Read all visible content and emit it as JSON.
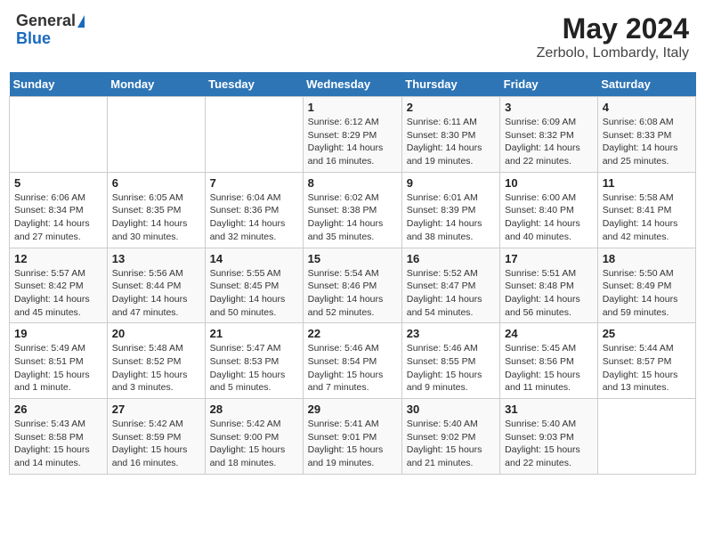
{
  "logo": {
    "line1": "General",
    "line2": "Blue"
  },
  "title": "May 2024",
  "subtitle": "Zerbolo, Lombardy, Italy",
  "days_header": [
    "Sunday",
    "Monday",
    "Tuesday",
    "Wednesday",
    "Thursday",
    "Friday",
    "Saturday"
  ],
  "weeks": [
    [
      {
        "num": "",
        "info": ""
      },
      {
        "num": "",
        "info": ""
      },
      {
        "num": "",
        "info": ""
      },
      {
        "num": "1",
        "info": "Sunrise: 6:12 AM\nSunset: 8:29 PM\nDaylight: 14 hours and 16 minutes."
      },
      {
        "num": "2",
        "info": "Sunrise: 6:11 AM\nSunset: 8:30 PM\nDaylight: 14 hours and 19 minutes."
      },
      {
        "num": "3",
        "info": "Sunrise: 6:09 AM\nSunset: 8:32 PM\nDaylight: 14 hours and 22 minutes."
      },
      {
        "num": "4",
        "info": "Sunrise: 6:08 AM\nSunset: 8:33 PM\nDaylight: 14 hours and 25 minutes."
      }
    ],
    [
      {
        "num": "5",
        "info": "Sunrise: 6:06 AM\nSunset: 8:34 PM\nDaylight: 14 hours and 27 minutes."
      },
      {
        "num": "6",
        "info": "Sunrise: 6:05 AM\nSunset: 8:35 PM\nDaylight: 14 hours and 30 minutes."
      },
      {
        "num": "7",
        "info": "Sunrise: 6:04 AM\nSunset: 8:36 PM\nDaylight: 14 hours and 32 minutes."
      },
      {
        "num": "8",
        "info": "Sunrise: 6:02 AM\nSunset: 8:38 PM\nDaylight: 14 hours and 35 minutes."
      },
      {
        "num": "9",
        "info": "Sunrise: 6:01 AM\nSunset: 8:39 PM\nDaylight: 14 hours and 38 minutes."
      },
      {
        "num": "10",
        "info": "Sunrise: 6:00 AM\nSunset: 8:40 PM\nDaylight: 14 hours and 40 minutes."
      },
      {
        "num": "11",
        "info": "Sunrise: 5:58 AM\nSunset: 8:41 PM\nDaylight: 14 hours and 42 minutes."
      }
    ],
    [
      {
        "num": "12",
        "info": "Sunrise: 5:57 AM\nSunset: 8:42 PM\nDaylight: 14 hours and 45 minutes."
      },
      {
        "num": "13",
        "info": "Sunrise: 5:56 AM\nSunset: 8:44 PM\nDaylight: 14 hours and 47 minutes."
      },
      {
        "num": "14",
        "info": "Sunrise: 5:55 AM\nSunset: 8:45 PM\nDaylight: 14 hours and 50 minutes."
      },
      {
        "num": "15",
        "info": "Sunrise: 5:54 AM\nSunset: 8:46 PM\nDaylight: 14 hours and 52 minutes."
      },
      {
        "num": "16",
        "info": "Sunrise: 5:52 AM\nSunset: 8:47 PM\nDaylight: 14 hours and 54 minutes."
      },
      {
        "num": "17",
        "info": "Sunrise: 5:51 AM\nSunset: 8:48 PM\nDaylight: 14 hours and 56 minutes."
      },
      {
        "num": "18",
        "info": "Sunrise: 5:50 AM\nSunset: 8:49 PM\nDaylight: 14 hours and 59 minutes."
      }
    ],
    [
      {
        "num": "19",
        "info": "Sunrise: 5:49 AM\nSunset: 8:51 PM\nDaylight: 15 hours and 1 minute."
      },
      {
        "num": "20",
        "info": "Sunrise: 5:48 AM\nSunset: 8:52 PM\nDaylight: 15 hours and 3 minutes."
      },
      {
        "num": "21",
        "info": "Sunrise: 5:47 AM\nSunset: 8:53 PM\nDaylight: 15 hours and 5 minutes."
      },
      {
        "num": "22",
        "info": "Sunrise: 5:46 AM\nSunset: 8:54 PM\nDaylight: 15 hours and 7 minutes."
      },
      {
        "num": "23",
        "info": "Sunrise: 5:46 AM\nSunset: 8:55 PM\nDaylight: 15 hours and 9 minutes."
      },
      {
        "num": "24",
        "info": "Sunrise: 5:45 AM\nSunset: 8:56 PM\nDaylight: 15 hours and 11 minutes."
      },
      {
        "num": "25",
        "info": "Sunrise: 5:44 AM\nSunset: 8:57 PM\nDaylight: 15 hours and 13 minutes."
      }
    ],
    [
      {
        "num": "26",
        "info": "Sunrise: 5:43 AM\nSunset: 8:58 PM\nDaylight: 15 hours and 14 minutes."
      },
      {
        "num": "27",
        "info": "Sunrise: 5:42 AM\nSunset: 8:59 PM\nDaylight: 15 hours and 16 minutes."
      },
      {
        "num": "28",
        "info": "Sunrise: 5:42 AM\nSunset: 9:00 PM\nDaylight: 15 hours and 18 minutes."
      },
      {
        "num": "29",
        "info": "Sunrise: 5:41 AM\nSunset: 9:01 PM\nDaylight: 15 hours and 19 minutes."
      },
      {
        "num": "30",
        "info": "Sunrise: 5:40 AM\nSunset: 9:02 PM\nDaylight: 15 hours and 21 minutes."
      },
      {
        "num": "31",
        "info": "Sunrise: 5:40 AM\nSunset: 9:03 PM\nDaylight: 15 hours and 22 minutes."
      },
      {
        "num": "",
        "info": ""
      }
    ]
  ]
}
